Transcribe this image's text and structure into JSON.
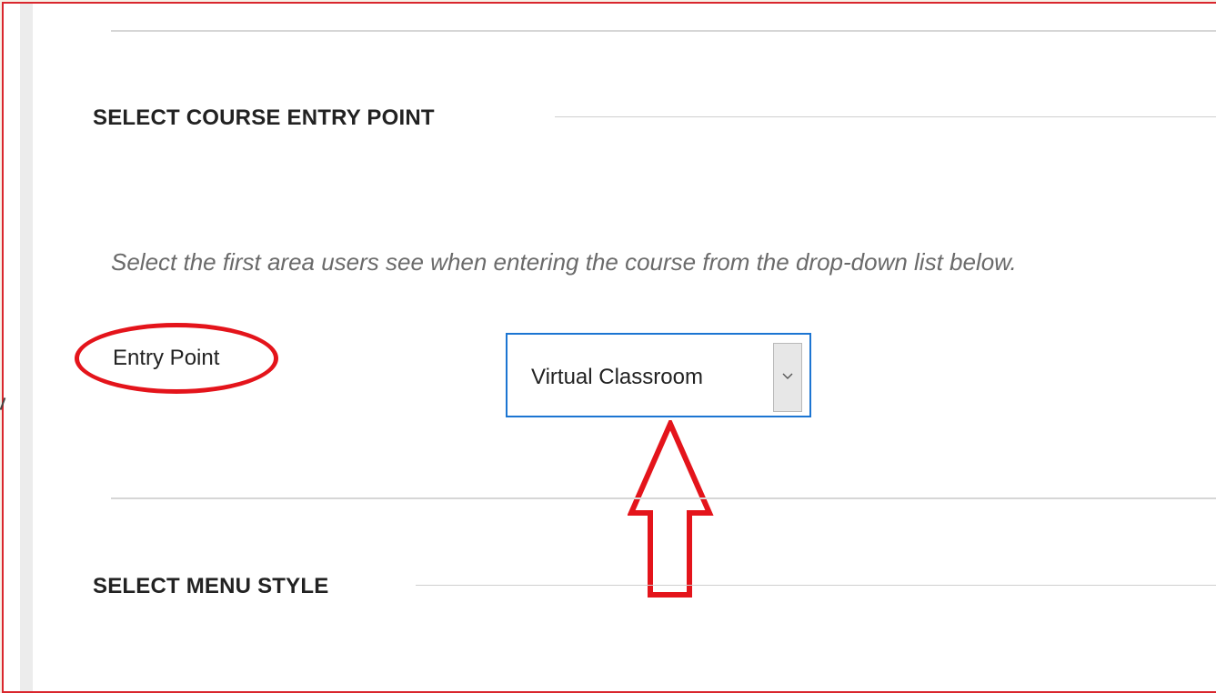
{
  "sections": {
    "entry_point": {
      "heading": "SELECT COURSE ENTRY POINT",
      "instructions": "Select the first area users see when entering the course from the drop-down list below.",
      "field_label": "Entry Point",
      "select_value": "Virtual Classroom"
    },
    "menu_style": {
      "heading": "SELECT MENU STYLE"
    }
  },
  "colors": {
    "annotation": "#e4141b",
    "focus_border": "#1c75d2",
    "frame_border": "#d9262d"
  }
}
